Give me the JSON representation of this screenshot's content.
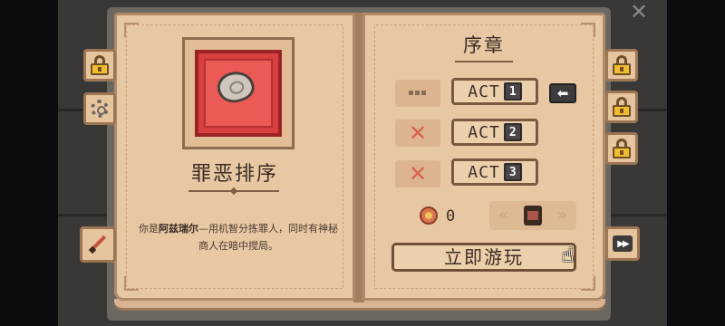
{
  "close": {
    "glyph": "✕"
  },
  "left_tabs": [
    {
      "icon": "lock-icon",
      "locked": true
    },
    {
      "icon": "gear-icon"
    },
    {
      "icon": "brush-icon"
    }
  ],
  "right_tabs": [
    {
      "icon": "lock-icon",
      "locked": true
    },
    {
      "icon": "lock-icon",
      "locked": true
    },
    {
      "icon": "lock-icon",
      "locked": true
    },
    {
      "icon": "fast-forward-icon",
      "glyph": "▶▶"
    }
  ],
  "left_page": {
    "artifact_icon": "stone-shell-icon",
    "title": "罪恶排序",
    "desc_bold": "阿兹瑞尔",
    "desc_prefix": "你是",
    "desc_suffix": "—用机智分拣罪人，同时有神秘商人在暗中搅局。"
  },
  "right_page": {
    "title": "序章",
    "acts": [
      {
        "label": "ACT",
        "number": "1",
        "status": "in-progress",
        "current": true
      },
      {
        "label": "ACT",
        "number": "2",
        "status": "locked",
        "current": false
      },
      {
        "label": "ACT",
        "number": "3",
        "status": "locked",
        "current": false
      }
    ],
    "status_glyphs": {
      "locked": "✕"
    },
    "arrow_glyph": "⬅",
    "medal_count": "0",
    "chevron_left": "«",
    "chevron_right": "»",
    "play_label": "立即游玩",
    "cursor_glyph": "☝"
  },
  "colors": {
    "page": "#e8c8a2",
    "accent_red": "#d84040",
    "lock_gold": "#f2bd2c",
    "locked_x": "#d9614f"
  }
}
